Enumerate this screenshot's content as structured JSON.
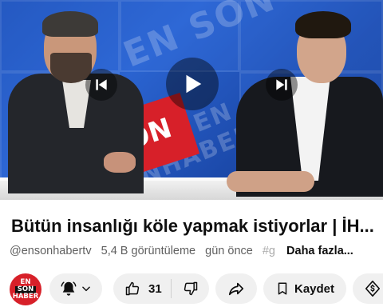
{
  "player": {
    "overlay_brand_1": "EN SON",
    "overlay_brand_2": "HABER EN SONHABER",
    "overlay_brand_red": "ON"
  },
  "video": {
    "title": "Bütün insanlığı köle yapmak istiyorlar | İH...",
    "channel_handle": "@ensonhabertv",
    "views": "5,4 B görüntüleme",
    "time_ago": "gün önce",
    "hashtag": "#g",
    "more_label": "Daha fazla..."
  },
  "channel": {
    "avatar_line1": "EN",
    "avatar_line2": "SON",
    "avatar_line3": "HABER"
  },
  "actions": {
    "like_count": "31",
    "save_label": "Kaydet"
  },
  "icons": {
    "prev": "skip-previous-icon",
    "play": "play-icon",
    "next": "skip-next-icon",
    "bell": "bell-icon",
    "like": "thumbs-up-icon",
    "dislike": "thumbs-down-icon",
    "share": "share-icon",
    "save": "bookmark-icon",
    "thanks": "thanks-dollar-icon"
  },
  "colors": {
    "brand_red": "#d72029",
    "pill_bg": "#f0f0f0",
    "studio_blue": "#1d4fb5"
  }
}
